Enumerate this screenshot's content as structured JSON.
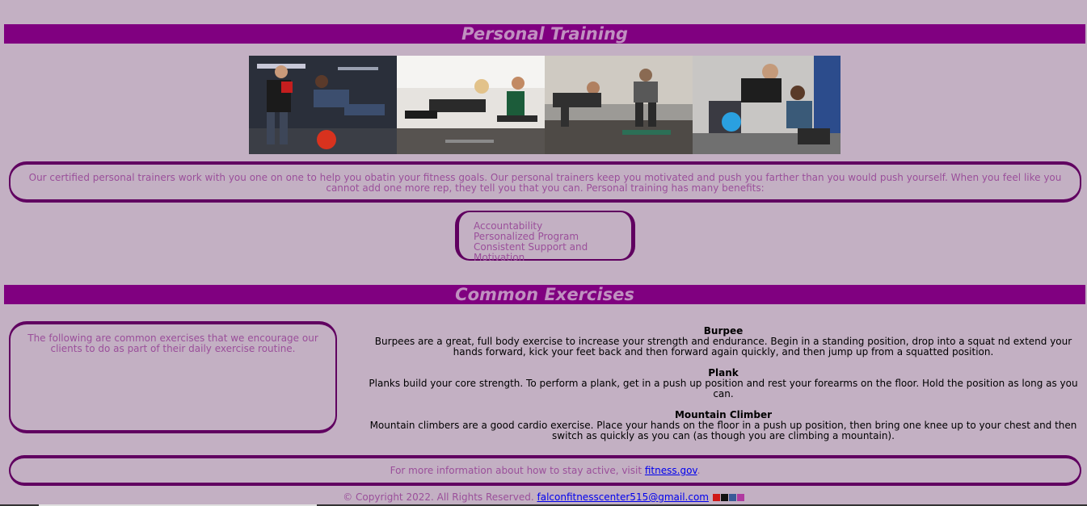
{
  "sections": {
    "personal_training_title": "Personal Training",
    "common_exercises_title": "Common Exercises"
  },
  "photos": [
    {
      "icon": "trainer-medicine-ball-photo"
    },
    {
      "icon": "plank-class-photo"
    },
    {
      "icon": "pushup-training-photo"
    },
    {
      "icon": "kettlebell-row-photo"
    }
  ],
  "intro": {
    "text": "Our certified personal trainers work with you one on one to help you obatin your fitness goals. Our personal trainers keep you motivated and push you farther than you would push yourself. When you feel like you cannot add one more rep, they tell you that you can. Personal training has many benefits:"
  },
  "benefits": [
    "Accountability",
    "Personalized Program",
    "Consistent Support and Motivation"
  ],
  "exercises_intro": {
    "text": "The following are common exercises that we encourage our clients to do as part of their daily exercise routine."
  },
  "exercises": [
    {
      "name": "Burpee",
      "description": "Burpees are a great, full body exercise to increase your strength and endurance. Begin in a standing position, drop into a squat nd extend your hands forward, kick your feet back and then forward again quickly, and then jump up from a squatted position."
    },
    {
      "name": "Plank",
      "description": "Planks build your core strength. To perform a plank, get in a push up position and rest your forearms on the floor. Hold the position as long as you can."
    },
    {
      "name": "Mountain Climber",
      "description": "Mountain climbers are a good cardio exercise. Place your hands on the floor in a push up position, then bring one knee up to your chest and then switch as quickly as you can (as though you are climbing a mountain)."
    }
  ],
  "more_info": {
    "prefix": "For more information about how to stay active, visit ",
    "link_text": "fitness.gov",
    "suffix": "."
  },
  "footer": {
    "copyright": "© Copyright 2022. All Rights Reserved.",
    "email": "falconfitnesscenter515@gmail.com",
    "social_icons": [
      "youtube-icon",
      "tiktok-icon",
      "facebook-icon",
      "instagram-icon"
    ]
  },
  "colors": {
    "background": "#c3b0c3",
    "banner": "#800080",
    "banner_text": "#c090c0",
    "body_text": "#9a4f9a",
    "border": "#600060"
  }
}
